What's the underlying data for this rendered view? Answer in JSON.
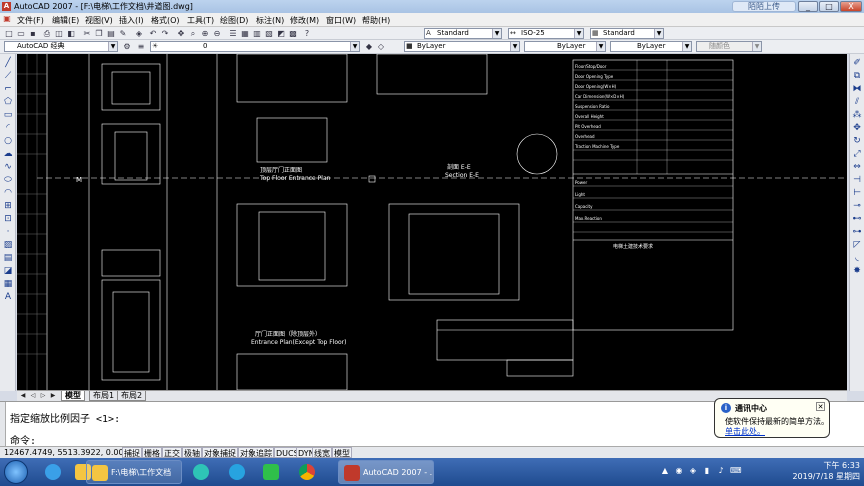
{
  "window": {
    "title": "AutoCAD 2007 - [F:\\电梯\\工作文档\\井道图.dwg]",
    "cloud_label": "陌陌上传",
    "minimize": "_",
    "maximize": "□",
    "close": "X"
  },
  "menu": [
    "文件(F)",
    "编辑(E)",
    "视图(V)",
    "插入(I)",
    "格式(O)",
    "工具(T)",
    "绘图(D)",
    "标注(N)",
    "修改(M)",
    "窗口(W)",
    "帮助(H)"
  ],
  "toolbar": {
    "text_style": "Standard",
    "dim_style": "ISO-25",
    "table_style": "Standard",
    "workspace": "AutoCAD 经典",
    "layer": "0",
    "color": "ByLayer",
    "linetype": "ByLayer",
    "lineweight": "ByLayer",
    "plot_style": "随颜色"
  },
  "drawing": {
    "label_top_entrance": "顶层厅门正面图",
    "label_top_entrance_en": "Top Floor Entrance Plan",
    "label_section": "剖面 E-E",
    "label_section_en": "Section E-E",
    "label_entrance": "厅门正面图（除顶层外）",
    "label_entrance_en": "Entrance Plan(Except Top Floor)",
    "axis_mark": "M",
    "spec_rows": [
      "Floor/Stop/Door",
      "Door Opening Type",
      "Door Opening(W×H)",
      "Car Dimension(W×D×H)",
      "Suspension Ratio",
      "Overall Height",
      "Pit Overhead",
      "Overhead",
      "Traction Machine Type",
      "Power",
      "Light",
      "Capacity",
      "Max.Reaction"
    ],
    "notes_title": "电梯土建技术要求"
  },
  "layout_tabs": [
    "模型",
    "布局1",
    "布局2"
  ],
  "command": {
    "prompt_line1": "指定缩放比例因子 <1>:",
    "prompt_line2": "命令:"
  },
  "status": {
    "coords": "12467.4749, 5513.3922, 0.0000",
    "buttons": [
      "捕捉",
      "栅格",
      "正交",
      "极轴",
      "对象捕捉",
      "对象追踪",
      "DUCS",
      "DYN",
      "线宽",
      "模型"
    ]
  },
  "balloon": {
    "title": "通讯中心",
    "body": "使软件保持最新的简单方法。",
    "link": "单击此处。"
  },
  "taskbar": {
    "app1": "F:\\电梯\\工作文档",
    "app2": "AutoCAD 2007 - ...",
    "time": "下午 6:33",
    "date": "2019/7/18 星期四"
  }
}
